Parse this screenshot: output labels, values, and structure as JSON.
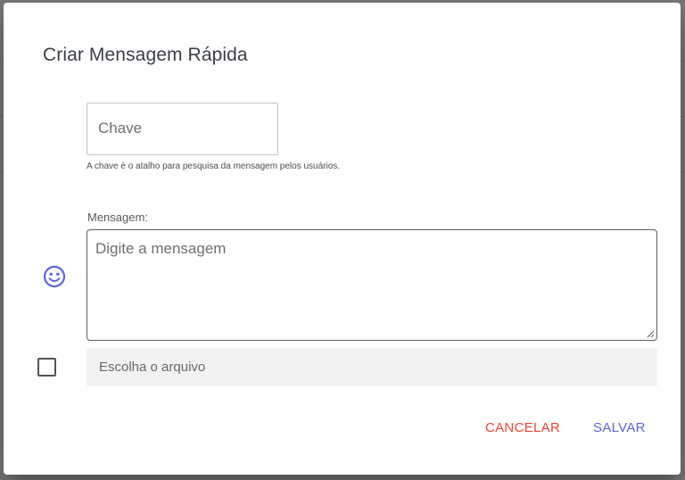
{
  "dialog": {
    "title": "Criar Mensagem Rápida"
  },
  "key": {
    "placeholder": "Chave",
    "value": "",
    "helper_text": "A chave é o atalho para pesquisa da mensagem pelos usuários."
  },
  "message": {
    "label": "Mensagem:",
    "placeholder": "Digite a mensagem",
    "value": ""
  },
  "emoji_button": {
    "icon": "smiley-icon",
    "color": "#5c63e4"
  },
  "attachment": {
    "checkbox_checked": false,
    "file_placeholder": "Escolha o arquivo"
  },
  "actions": {
    "cancel_label": "CANCELAR",
    "cancel_color": "#f44336",
    "save_label": "SALVAR",
    "save_color": "#5c63e4"
  }
}
